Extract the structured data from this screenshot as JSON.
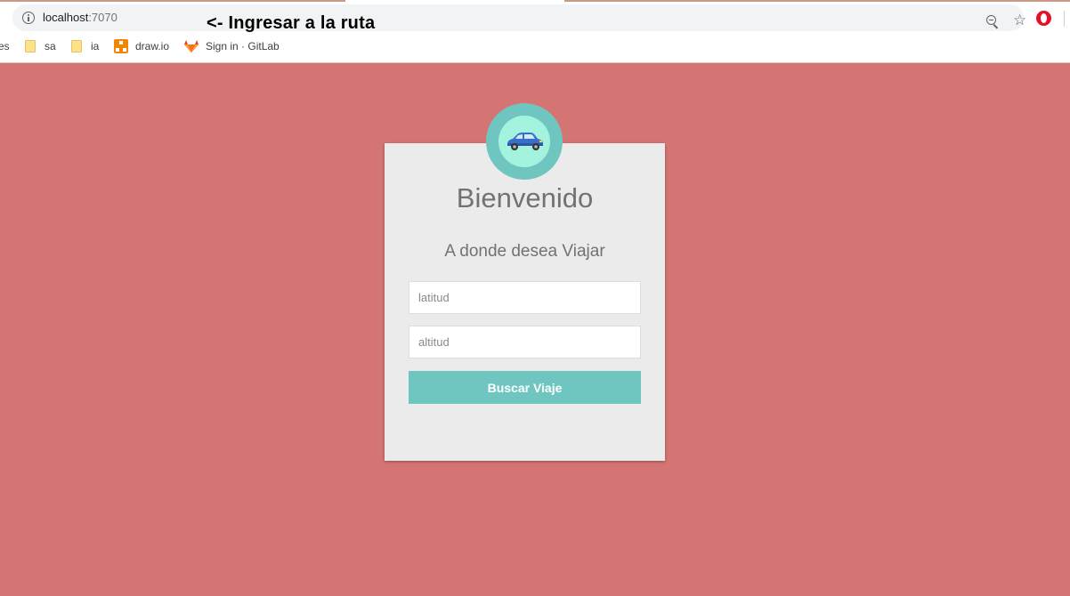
{
  "browser": {
    "url_host": "localhost",
    "url_port": ":7070",
    "annotation": "<- Ingresar a la ruta",
    "icons": {
      "info": "info-icon",
      "zoom": "zoom-out-icon",
      "star": "star-icon",
      "opera": "opera-icon"
    }
  },
  "bookmarks": [
    {
      "label": "es",
      "icon": "none"
    },
    {
      "label": "sa",
      "icon": "folder-icon"
    },
    {
      "label": "ia",
      "icon": "folder-icon"
    },
    {
      "label": "draw.io",
      "icon": "drawio-icon"
    },
    {
      "label": "Sign in · GitLab",
      "icon": "gitlab-icon"
    }
  ],
  "login_card": {
    "avatar_icon": "car-icon",
    "title": "Bienvenido",
    "subtitle": "A donde desea Viajar",
    "latitude_placeholder": "latitud",
    "latitude_value": "",
    "altitude_placeholder": "altitud",
    "altitude_value": "",
    "submit_label": "Buscar Viaje"
  },
  "colors": {
    "background": "#d47574",
    "card": "#ebebeb",
    "accent": "#6fc6c0",
    "avatar_inner": "#a3f3de",
    "text_muted": "#727272"
  }
}
